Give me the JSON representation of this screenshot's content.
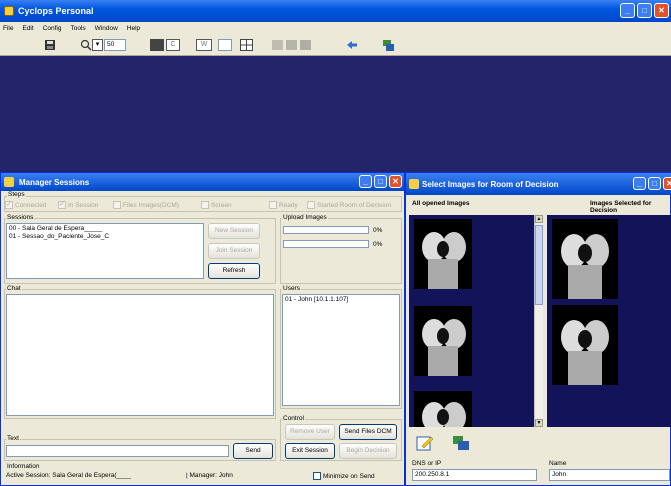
{
  "app": {
    "title": "Cyclops Personal",
    "menu": [
      "File",
      "Edit",
      "Config",
      "Tools",
      "Window",
      "Help"
    ],
    "zoom_value": "50",
    "toolbar_c": "C",
    "toolbar_w": "W"
  },
  "manager": {
    "title": "Manager Sessions",
    "steps_label": "Steps",
    "steps": [
      "Connected",
      "In Session",
      "Files Images(DCM)",
      "Screen",
      "Ready",
      "Started Room of Decision"
    ],
    "sessions_label": "Sessions",
    "sessions": [
      "00 - Sala Geral de Espera_____",
      "01 - Sessao_do_Paciente_Jose_C"
    ],
    "new_session": "New Session",
    "join_session": "Join Session",
    "refresh": "Refresh",
    "upload_label": "Upload Images",
    "upload_pct1": "0%",
    "upload_pct2": "0%",
    "chat_label": "Chat",
    "users_label": "Users",
    "users": [
      "01 - John [10.1.1.107]"
    ],
    "control_label": "Control",
    "remove_user": "Remove User",
    "send_files_dcm": "Send Files DCM",
    "exit_session": "Exit Session",
    "begin_decision": "Begin Decision",
    "text_label": "Text",
    "send": "Send",
    "info_label": "Information",
    "active_session": "Active Session:  Sala Geral de Espera(____",
    "manager_text": "|  Manager: John",
    "minimize_on_send": "Minimize on Send"
  },
  "select_images": {
    "title": "Select Images for Room of Decision",
    "all_opened": "All opened Images",
    "selected": "Images Selected for Decision",
    "dns_label": "DNS or IP",
    "dns_value": "200.250.8.1",
    "name_label": "Name",
    "name_value": "John"
  },
  "colors": {
    "titlebar": "#0058e0",
    "window_bg": "#ece9d8",
    "workspace": "#24246a",
    "panel": "#13135a"
  }
}
